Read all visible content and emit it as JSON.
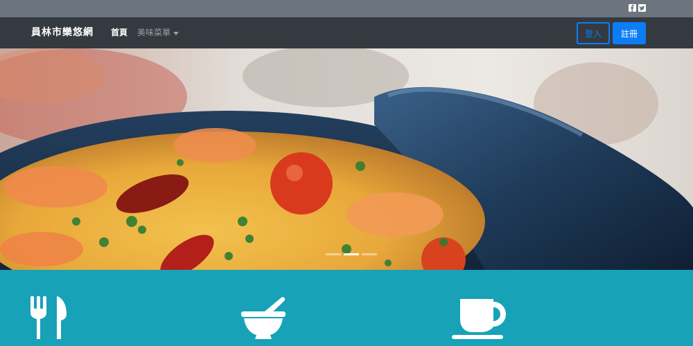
{
  "topbar": {
    "social": [
      "facebook-icon",
      "twitter-icon"
    ]
  },
  "navbar": {
    "brand": "員林市欒悠網",
    "home": "首頁",
    "menu": "美味菜單",
    "login": "登入",
    "register": "註冊"
  },
  "hero": {
    "slide_count": 3,
    "active_slide": 2
  },
  "features": {
    "icons": [
      "utensils-icon",
      "mortar-pestle-icon",
      "coffee-cup-icon"
    ]
  },
  "colors": {
    "topbar": "#6c757d",
    "navbar": "#343a40",
    "primary": "#0d7df5",
    "features_bg": "#17a2b8"
  }
}
